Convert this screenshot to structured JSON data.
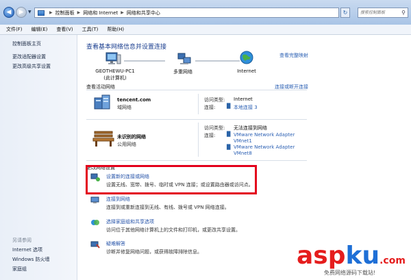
{
  "address_bar": {
    "crumbs": [
      "控制面板",
      "网络和 Internet",
      "网络和共享中心"
    ],
    "search_placeholder": "搜索控制面板"
  },
  "menu": [
    "文件(F)",
    "编辑(E)",
    "查看(V)",
    "工具(T)",
    "帮助(H)"
  ],
  "left_pane": {
    "items": [
      "控制面板主页",
      "更改适配器设置",
      "更改高级共享设置"
    ],
    "see_also_header": "另请参阅",
    "see_also": [
      "Internet 选项",
      "Windows 防火墙",
      "家庭组"
    ]
  },
  "main": {
    "title": "查看基本网络信息并设置连接",
    "full_map_link": "查看完整映射",
    "map": {
      "computer_name": "GEOTHEWU-PC1",
      "computer_sub": "(此计算机)",
      "middle": "多重网络",
      "right": "Internet"
    },
    "active_header": "查看活动网络",
    "connect_link": "连接或断开连接",
    "networks": [
      {
        "name": "tencent.com",
        "type": "域网络",
        "access_label": "访问类型:",
        "access_value": "Internet",
        "conn_label": "连接:",
        "conn_values": [
          "本地连接 3"
        ]
      },
      {
        "name": "未识别的网络",
        "type": "公用网络",
        "access_label": "访问类型:",
        "access_value": "无法连接到网络",
        "conn_label": "连接:",
        "conn_values": [
          "VMware Network Adapter VMnet1",
          "VMware Network Adapter VMnet8"
        ]
      }
    ],
    "change_header": "更改网络设置",
    "tasks": [
      {
        "title": "设置新的连接或网络",
        "desc": "设置无线、宽带、拨号、临时或 VPN 连接；或设置路由器或访问点。"
      },
      {
        "title": "连接到网络",
        "desc": "连接到或重新连接到无线、有线、拨号或 VPN 网络连接。"
      },
      {
        "title": "选择家庭组和共享选项",
        "desc": "访问位于其他网络计算机上的文件和打印机，或更改共享设置。"
      },
      {
        "title": "疑难解答",
        "desc": "诊断并修复网络问题，或获得故障排除信息。"
      }
    ]
  },
  "watermark": {
    "brand_a": "asp",
    "brand_b": "ku",
    "brand_c": ".com",
    "sub": "免费网络源码下载站!"
  },
  "colors": {
    "accent_link": "#2a5fb3",
    "title_blue": "#1a3e8f",
    "highlight_red": "#e3001b"
  }
}
